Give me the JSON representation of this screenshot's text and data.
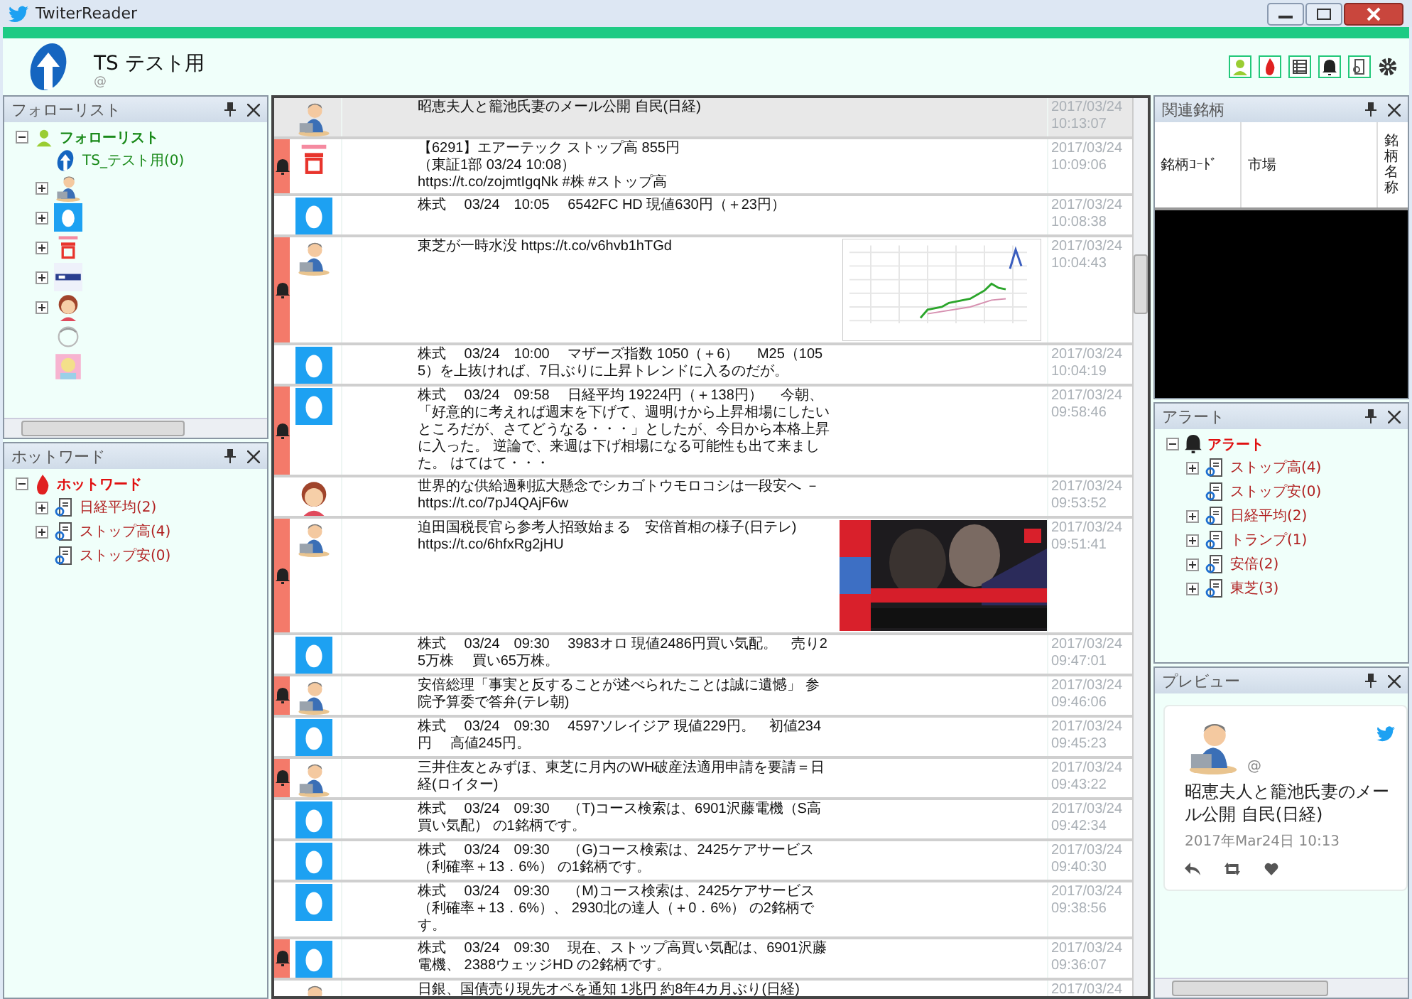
{
  "window": {
    "title": "TwiterReader"
  },
  "account": {
    "name": "TS テスト用",
    "handle": "@"
  },
  "toolbar": [
    {
      "kind": "person"
    },
    {
      "kind": "flame"
    },
    {
      "kind": "list"
    },
    {
      "kind": "bell"
    },
    {
      "kind": "search"
    },
    {
      "kind": "gear"
    }
  ],
  "follow_panel": {
    "title": "フォローリスト",
    "root": {
      "label": "フォローリスト",
      "expanded": true,
      "children": [
        {
          "kind": "logo",
          "label": "TS_テスト用(0)",
          "expandable": false
        },
        {
          "kind": "man",
          "expandable": true
        },
        {
          "kind": "egg",
          "expandable": true
        },
        {
          "kind": "stop",
          "expandable": true
        },
        {
          "kind": "news",
          "expandable": true
        },
        {
          "kind": "girl",
          "expandable": true
        },
        {
          "kind": "sketch",
          "expandable": false
        },
        {
          "kind": "anime",
          "expandable": false
        }
      ]
    }
  },
  "hotword_panel": {
    "title": "ホットワード",
    "root": {
      "label": "ホットワード",
      "expanded": true,
      "children": [
        {
          "label": "日経平均(2)",
          "expandable": true
        },
        {
          "label": "ストップ高(4)",
          "expandable": true
        },
        {
          "label": "ストップ安(0)",
          "expandable": false
        }
      ]
    }
  },
  "feed": {
    "rows": [
      {
        "kind": "man",
        "alert": false,
        "selected": true,
        "lines": [
          "昭恵夫人と籠池氏妻のメール公開  自民(日経)"
        ],
        "date": "2017/03/24",
        "time": "10:13:07"
      },
      {
        "kind": "stop",
        "alert": true,
        "selected": false,
        "lines": [
          "【6291】エアーテック  ストップ高 855円",
          "（東証1部 03/24 10:08）",
          "https://t.co/zojmtIgqNk #株 #ストップ高"
        ],
        "date": "2017/03/24",
        "time": "10:09:06"
      },
      {
        "kind": "egg",
        "alert": false,
        "selected": false,
        "lines": [
          "株式　 03/24　10:05　 6542FC HD  現値630円（＋23円）"
        ],
        "date": "2017/03/24",
        "time": "10:08:38"
      },
      {
        "kind": "man",
        "alert": true,
        "selected": false,
        "lines": [
          "東芝が一時水没 https://t.co/v6hvb1hTGd"
        ],
        "media": {
          "kind": "chart"
        },
        "date": "2017/03/24",
        "time": "10:04:43"
      },
      {
        "kind": "egg",
        "alert": false,
        "selected": false,
        "lines": [
          "株式　 03/24　10:00　 マザーズ指数  1050（＋6）　 M25（1055）を上抜ければ、7日ぶりに上昇トレンドに入るのだが。"
        ],
        "date": "2017/03/24",
        "time": "10:04:19"
      },
      {
        "kind": "egg",
        "alert": true,
        "selected": false,
        "lines": [
          "株式　 03/24　09:58　 日経平均  19224円（＋138円）　 今朝、「好意的に考えれば週末を下げて、週明けから上昇相場にしたいところだが、さてどうなる・・・」としたが、今日から本格上昇に入った。 逆論で、来週は下げ相場になる可能性も出て来ました。 はてはて・・・"
        ],
        "date": "2017/03/24",
        "time": "09:58:46"
      },
      {
        "kind": "girl",
        "alert": false,
        "selected": false,
        "lines": [
          "世界的な供給過剰拡大懸念でシカゴトウモロコシは一段安へ －",
          "https://t.co/7pJ4QAjF6w"
        ],
        "date": "2017/03/24",
        "time": "09:53:52"
      },
      {
        "kind": "man",
        "alert": true,
        "selected": false,
        "lines": [
          "迫田国税長官ら参考人招致始まる　安倍首相の様子(日テレ)",
          "https://t.co/6hfxRg2jHU"
        ],
        "media": {
          "kind": "picture"
        },
        "date": "2017/03/24",
        "time": "09:51:41"
      },
      {
        "kind": "egg",
        "alert": false,
        "selected": false,
        "lines": [
          "株式　 03/24　09:30　 3983オロ  現値2486円買い気配。　売り25万株　 買い65万株。"
        ],
        "date": "2017/03/24",
        "time": "09:47:01"
      },
      {
        "kind": "man",
        "alert": true,
        "selected": false,
        "lines": [
          "安倍総理「事実と反することが述べられたことは誠に遺憾」 参院予算委で答弁(テレ朝)"
        ],
        "date": "2017/03/24",
        "time": "09:46:06"
      },
      {
        "kind": "egg",
        "alert": false,
        "selected": false,
        "lines": [
          "株式　 03/24　09:30　 4597ソレイジア  現値229円。　初値234円　 高値245円。"
        ],
        "date": "2017/03/24",
        "time": "09:45:23"
      },
      {
        "kind": "man",
        "alert": true,
        "selected": false,
        "lines": [
          "三井住友とみずほ、東芝に月内のWH破産法適用申請を要請＝日経(ロイター)"
        ],
        "date": "2017/03/24",
        "time": "09:43:22"
      },
      {
        "kind": "egg",
        "alert": false,
        "selected": false,
        "lines": [
          "株式　 03/24　09:30　 （T)コース検索は、6901沢藤電機（S高買い気配） の1銘柄です。"
        ],
        "date": "2017/03/24",
        "time": "09:42:34"
      },
      {
        "kind": "egg",
        "alert": false,
        "selected": false,
        "lines": [
          "株式　 03/24　09:30　 （G)コース検索は、2425ケアサービス（利確率＋13．6%） の1銘柄です。"
        ],
        "date": "2017/03/24",
        "time": "09:40:30"
      },
      {
        "kind": "egg",
        "alert": false,
        "selected": false,
        "lines": [
          "株式　 03/24　09:30　 （M)コース検索は、2425ケアサービス（利確率＋13．6%）、 2930北の達人（＋0．6%） の2銘柄です。"
        ],
        "date": "2017/03/24",
        "time": "09:38:56"
      },
      {
        "kind": "egg",
        "alert": true,
        "selected": false,
        "lines": [
          "株式　 03/24　09:30　 現在、ストップ高買い気配は、6901沢藤電機、 2388ウェッジHD  の2銘柄です。"
        ],
        "date": "2017/03/24",
        "time": "09:36:07"
      },
      {
        "kind": "man",
        "alert": false,
        "selected": false,
        "lines": [
          "日銀、国債売り現先オペを通知  1兆円  約8年4カ月ぶり(日経)"
        ],
        "date": "2017/03/24"
      }
    ]
  },
  "related_panel": {
    "title": "関連銘柄",
    "columns": [
      "銘柄ｺｰﾄﾞ",
      "市場",
      "銘柄名称"
    ]
  },
  "alert_panel": {
    "title": "アラート",
    "root": {
      "label": "アラート",
      "expanded": true,
      "children": [
        {
          "label": "ストップ高(4)",
          "expandable": true
        },
        {
          "label": "ストップ安(0)",
          "expandable": false
        },
        {
          "label": "日経平均(2)",
          "expandable": true
        },
        {
          "label": "トランプ(1)",
          "expandable": true
        },
        {
          "label": "安倍(2)",
          "expandable": true
        },
        {
          "label": "東芝(3)",
          "expandable": true
        }
      ]
    }
  },
  "preview_panel": {
    "title": "プレビュー",
    "handle": "@",
    "text": "昭恵夫人と籠池氏妻のメール公開  自民(日経)",
    "date": "2017年Mar24日  10:13"
  }
}
